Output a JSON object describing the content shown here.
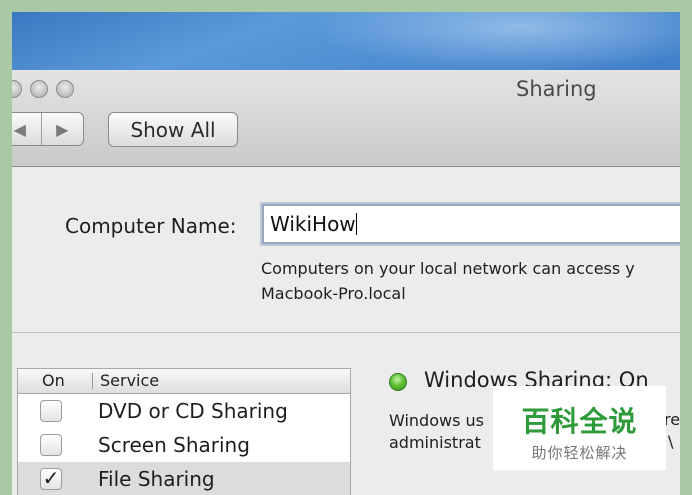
{
  "window": {
    "title": "Sharing"
  },
  "toolbar": {
    "back_glyph": "◀",
    "forward_glyph": "▶",
    "show_all_label": "Show All"
  },
  "computer_name": {
    "label": "Computer Name:",
    "value": "WikiHow",
    "description_line1": "Computers on your local network can access y",
    "description_line2": "Macbook-Pro.local"
  },
  "services": {
    "header_on": "On",
    "header_service": "Service",
    "items": [
      {
        "label": "DVD or CD Sharing",
        "checked": false,
        "check_glyph": ""
      },
      {
        "label": "Screen Sharing",
        "checked": false,
        "check_glyph": ""
      },
      {
        "label": "File Sharing",
        "checked": true,
        "check_glyph": "✓"
      }
    ]
  },
  "status": {
    "title": "Windows Sharing: On",
    "indicator_color": "#5fc233",
    "desc_line1": "Windows us",
    "desc_line2": "administrat",
    "desc_right1": "re",
    "desc_right2": "\\"
  },
  "watermark": {
    "main": "百科全说",
    "sub": "助你轻松解决"
  },
  "icons": {
    "traffic_lights": "window-control-icon",
    "status": "status-on-indicator-icon",
    "check": "checkmark-icon"
  }
}
